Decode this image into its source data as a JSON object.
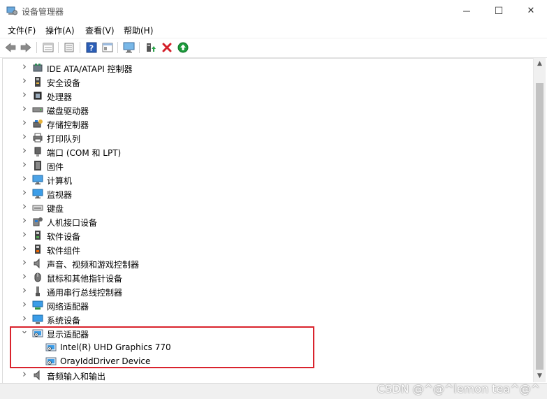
{
  "window": {
    "title": "设备管理器",
    "minimize_glyph": "—",
    "maximize_glyph": "☐",
    "close_glyph": "✕"
  },
  "menubar": {
    "items": [
      "文件(F)",
      "操作(A)",
      "查看(V)",
      "帮助(H)"
    ]
  },
  "toolbar": {
    "buttons": [
      "back-arrow-icon",
      "forward-arrow-icon",
      "properties-icon",
      "driver-icon",
      "help-icon",
      "view-icon",
      "monitor-scan-icon",
      "update-driver-icon",
      "uninstall-x-icon",
      "enable-device-icon"
    ]
  },
  "tree": {
    "items": [
      {
        "label": "IDE ATA/ATAPI 控制器",
        "icon": "ide-controller-icon",
        "expanded": false
      },
      {
        "label": "安全设备",
        "icon": "security-device-icon",
        "expanded": false
      },
      {
        "label": "处理器",
        "icon": "processor-icon",
        "expanded": false
      },
      {
        "label": "磁盘驱动器",
        "icon": "disk-drive-icon",
        "expanded": false
      },
      {
        "label": "存储控制器",
        "icon": "storage-controller-icon",
        "expanded": false
      },
      {
        "label": "打印队列",
        "icon": "printer-icon",
        "expanded": false
      },
      {
        "label": "端口 (COM 和 LPT)",
        "icon": "port-icon",
        "expanded": false
      },
      {
        "label": "固件",
        "icon": "firmware-icon",
        "expanded": false
      },
      {
        "label": "计算机",
        "icon": "computer-icon",
        "expanded": false
      },
      {
        "label": "监视器",
        "icon": "monitor-icon",
        "expanded": false
      },
      {
        "label": "键盘",
        "icon": "keyboard-icon",
        "expanded": false
      },
      {
        "label": "人机接口设备",
        "icon": "hid-icon",
        "expanded": false
      },
      {
        "label": "软件设备",
        "icon": "software-device-icon",
        "expanded": false
      },
      {
        "label": "软件组件",
        "icon": "software-component-icon",
        "expanded": false
      },
      {
        "label": "声音、视频和游戏控制器",
        "icon": "speaker-icon",
        "expanded": false
      },
      {
        "label": "鼠标和其他指针设备",
        "icon": "mouse-icon",
        "expanded": false
      },
      {
        "label": "通用串行总线控制器",
        "icon": "usb-icon",
        "expanded": false
      },
      {
        "label": "网络适配器",
        "icon": "network-adapter-icon",
        "expanded": false
      },
      {
        "label": "系统设备",
        "icon": "system-device-icon",
        "expanded": false
      },
      {
        "label": "显示适配器",
        "icon": "display-adapter-icon",
        "expanded": true
      },
      {
        "label": "Intel(R) UHD Graphics 770",
        "icon": "display-adapter-icon",
        "child": true
      },
      {
        "label": "OrayIddDriver Device",
        "icon": "display-adapter-icon",
        "child": true
      },
      {
        "label": "音频输入和输出",
        "icon": "speaker-icon",
        "expanded": false
      }
    ]
  },
  "watermark": "CSDN @^@^lemon tea^@^",
  "colors": {
    "highlight_border": "#d9232d",
    "accent_blue": "#1a73c7",
    "green": "#1a9a3a",
    "red": "#d4202a"
  }
}
